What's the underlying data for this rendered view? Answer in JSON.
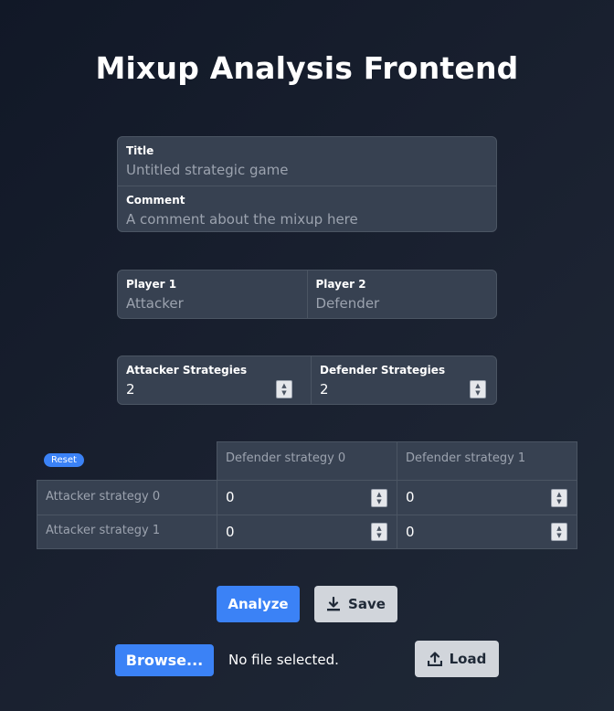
{
  "page": {
    "title": "Mixup Analysis Frontend"
  },
  "meta": {
    "title_label": "Title",
    "title_placeholder": "Untitled strategic game",
    "comment_label": "Comment",
    "comment_placeholder": "A comment about the mixup here"
  },
  "players": {
    "p1_label": "Player 1",
    "p1_placeholder": "Attacker",
    "p2_label": "Player 2",
    "p2_placeholder": "Defender"
  },
  "strategies": {
    "attacker_label": "Attacker Strategies",
    "attacker_value": "2",
    "defender_label": "Defender Strategies",
    "defender_value": "2"
  },
  "matrix": {
    "reset_label": "Reset",
    "col_headers": [
      "Defender strategy 0",
      "Defender strategy 1"
    ],
    "row_headers": [
      "Attacker strategy 0",
      "Attacker strategy 1"
    ],
    "values": [
      [
        "0",
        "0"
      ],
      [
        "0",
        "0"
      ]
    ]
  },
  "actions": {
    "analyze_label": "Analyze",
    "save_label": "Save",
    "browse_label": "Browse...",
    "file_status": "No file selected.",
    "load_label": "Load"
  },
  "icons": {
    "save": "download-icon",
    "load": "upload-icon",
    "spinner": "spinner-arrows-icon"
  },
  "colors": {
    "accent": "#3b82f6",
    "panel": "#374151",
    "secondary_button": "#d1d5db"
  }
}
